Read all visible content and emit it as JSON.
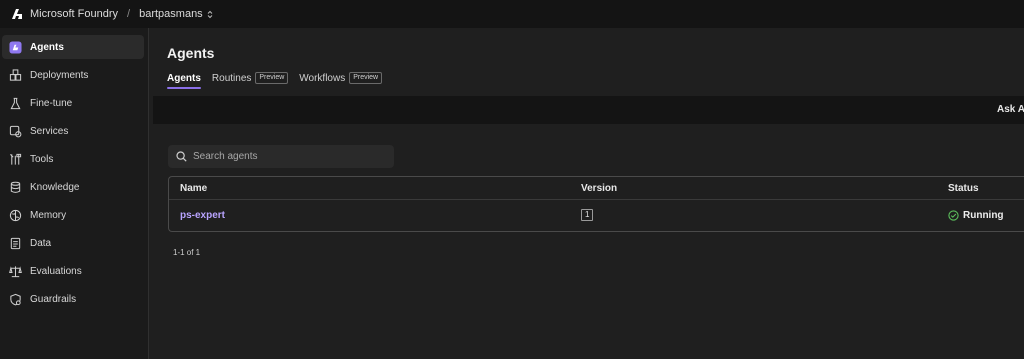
{
  "topbar": {
    "brand": "Microsoft Foundry",
    "separator": "/",
    "project": "bartpasmans"
  },
  "sidebar": {
    "items": [
      {
        "label": "Agents",
        "icon": "agents-icon",
        "active": true
      },
      {
        "label": "Deployments",
        "icon": "cubes-icon"
      },
      {
        "label": "Fine-tune",
        "icon": "flask-icon"
      },
      {
        "label": "Services",
        "icon": "services-icon"
      },
      {
        "label": "Tools",
        "icon": "tools-icon"
      },
      {
        "label": "Knowledge",
        "icon": "database-icon"
      },
      {
        "label": "Memory",
        "icon": "brain-icon"
      },
      {
        "label": "Data",
        "icon": "document-icon"
      },
      {
        "label": "Evaluations",
        "icon": "scale-icon"
      },
      {
        "label": "Guardrails",
        "icon": "shield-icon"
      }
    ]
  },
  "main": {
    "title": "Agents",
    "tabs": [
      {
        "label": "Agents",
        "active": true
      },
      {
        "label": "Routines",
        "badge": "Preview"
      },
      {
        "label": "Workflows",
        "badge": "Preview"
      }
    ],
    "ask_ai": "Ask AI",
    "search": {
      "placeholder": "Search agents"
    },
    "table": {
      "columns": [
        "Name",
        "Version",
        "Status"
      ],
      "rows": [
        {
          "name": "ps-expert",
          "version": "1",
          "status": "Running"
        }
      ]
    },
    "pagination": "1-1 of 1"
  },
  "colors": {
    "accent": "#8a6fe8",
    "link": "#b9a4ff",
    "status_running": "#5cbf5c"
  }
}
